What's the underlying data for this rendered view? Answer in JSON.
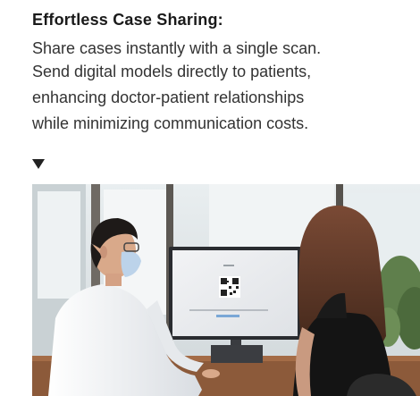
{
  "feature": {
    "heading": "Effortless Case Sharing:",
    "lines": [
      "Share cases instantly with a single scan.",
      "Send digital models directly to patients,",
      "enhancing doctor-patient relationships",
      "while minimizing communication costs."
    ]
  },
  "icons": {
    "pointer": "down-triangle-icon"
  },
  "colors": {
    "text": "#333333",
    "heading": "#1a1a1a"
  }
}
